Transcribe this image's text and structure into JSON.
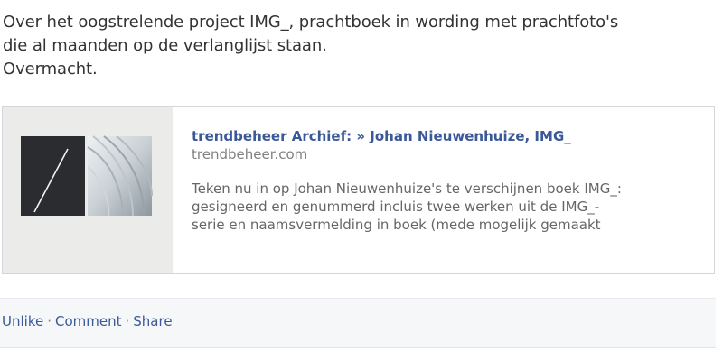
{
  "post": {
    "message_lines": [
      "Over het oogstrelende project IMG_, prachtboek in wording met prachtfoto's",
      "die al maanden op de verlanglijst staan.",
      "Overmacht."
    ]
  },
  "share": {
    "thumbnail_icon": "book-cover-thumbnail",
    "title": "trendbeheer Archief: » Johan Nieuwenhuize, IMG_",
    "domain": "trendbeheer.com",
    "description_lines": [
      "Teken nu in op Johan Nieuwenhuize's te verschijnen boek IMG_:",
      "gesigneerd en genummerd incluis twee werken uit de IMG_-",
      "serie en naamsvermelding in boek (mede mogelijk gemaakt"
    ]
  },
  "actions": {
    "unlike": "Unlike",
    "comment": "Comment",
    "share": "Share",
    "separator": "·"
  },
  "colors": {
    "link": "#3b5998",
    "text": "#333333",
    "muted": "#7f7f7f",
    "thumb_bg": "#ebebea"
  }
}
